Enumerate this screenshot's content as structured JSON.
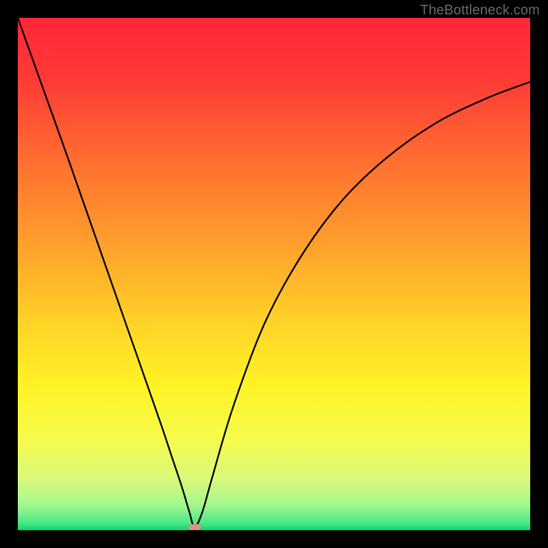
{
  "watermark": "TheBottleneck.com",
  "chart_data": {
    "type": "line",
    "title": "",
    "xlabel": "",
    "ylabel": "",
    "xlim": [
      0,
      100
    ],
    "ylim": [
      0,
      100
    ],
    "grid": false,
    "series": [
      {
        "name": "bottleneck-curve",
        "x": [
          0,
          5,
          10,
          15,
          20,
          25,
          28,
          30,
          32,
          33.5,
          34.5,
          36,
          38,
          42,
          48,
          55,
          63,
          72,
          82,
          92,
          100
        ],
        "y": [
          100,
          86,
          72,
          57.7,
          43.4,
          29.1,
          20.5,
          14.5,
          8.5,
          3.5,
          0.6,
          3.5,
          10.5,
          24,
          40,
          53,
          64,
          72.7,
          79.7,
          84.5,
          87.5
        ]
      }
    ],
    "marker": {
      "x": 34.5,
      "y": 0.6,
      "color": "#eb8a86"
    },
    "background_gradient": {
      "stops": [
        {
          "offset": 0.0,
          "color": "#ff2738"
        },
        {
          "offset": 0.12,
          "color": "#ff3a36"
        },
        {
          "offset": 0.28,
          "color": "#ff6f30"
        },
        {
          "offset": 0.45,
          "color": "#ffa22c"
        },
        {
          "offset": 0.6,
          "color": "#ffd427"
        },
        {
          "offset": 0.72,
          "color": "#fff326"
        },
        {
          "offset": 0.82,
          "color": "#f6fb4a"
        },
        {
          "offset": 0.9,
          "color": "#d9f97a"
        },
        {
          "offset": 0.95,
          "color": "#a4f78f"
        },
        {
          "offset": 0.985,
          "color": "#4ee987"
        },
        {
          "offset": 1.0,
          "color": "#00d977"
        }
      ]
    }
  }
}
